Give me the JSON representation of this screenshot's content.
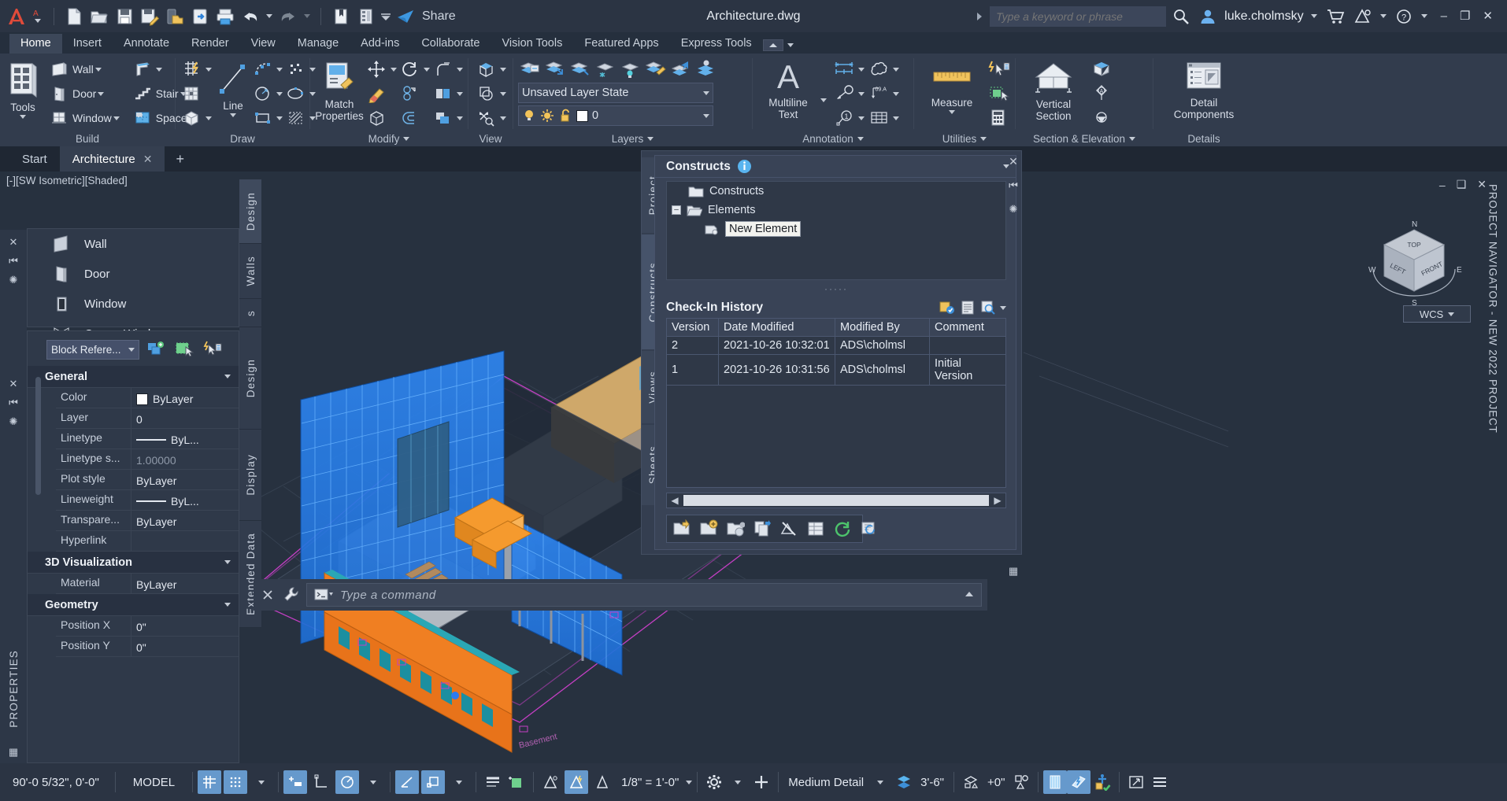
{
  "titlebar": {
    "app_icon": "autocad-A-icon",
    "quick_access": [
      {
        "name": "new-file-icon",
        "label": "New"
      },
      {
        "name": "open-file-icon",
        "label": "Open"
      },
      {
        "name": "save-icon",
        "label": "Save"
      },
      {
        "name": "save-as-icon",
        "label": "Save As"
      },
      {
        "name": "save-to-web-icon",
        "label": "Save to Web & Mobile"
      },
      {
        "name": "open-from-web-icon",
        "label": "Open from Web & Mobile"
      },
      {
        "name": "plot-icon",
        "label": "Plot"
      },
      {
        "name": "undo-icon",
        "label": "Undo"
      },
      {
        "name": "redo-icon",
        "label": "Redo"
      },
      {
        "name": "sheet-set-icon",
        "label": "Sheet Set Manager"
      },
      {
        "name": "project-navigator-icon",
        "label": "Project Navigator"
      }
    ],
    "share_label": "Share",
    "document_title": "Architecture.dwg",
    "search_placeholder": "Type a keyword or phrase",
    "user_name": "luke.cholmsky",
    "window_buttons": {
      "minimize": "–",
      "restore": "❐",
      "close": "✕"
    }
  },
  "ribbon_tabs": [
    {
      "label": "Home",
      "active": true
    },
    {
      "label": "Insert",
      "active": false
    },
    {
      "label": "Annotate",
      "active": false
    },
    {
      "label": "Render",
      "active": false
    },
    {
      "label": "View",
      "active": false
    },
    {
      "label": "Manage",
      "active": false
    },
    {
      "label": "Add-ins",
      "active": false
    },
    {
      "label": "Collaborate",
      "active": false
    },
    {
      "label": "Vision Tools",
      "active": false
    },
    {
      "label": "Featured Apps",
      "active": false
    },
    {
      "label": "Express Tools",
      "active": false
    }
  ],
  "ribbon": {
    "build": {
      "label": "Build",
      "tools_label_1": "Tools",
      "items": [
        {
          "label": "Wall",
          "icon": "wall-icon"
        },
        {
          "label": "Door",
          "icon": "door-icon"
        },
        {
          "label": "Window",
          "icon": "window-icon"
        },
        {
          "label": "",
          "icon": "curtain-wall-icon"
        },
        {
          "label": "Stair",
          "icon": "stair-icon"
        },
        {
          "label": "Space",
          "icon": "space-icon"
        }
      ]
    },
    "draw": {
      "label": "Draw",
      "line_label": "Line",
      "icons": [
        "grid-snap-icon",
        "array-icon",
        "box-icon",
        "arc-icon",
        "circle-icon",
        "rectangle-icon",
        "point-icon",
        "ellipse-icon",
        "hatch-icon"
      ]
    },
    "modify": {
      "label": "Modify",
      "match_label_1": "Match",
      "match_label_2": "Properties",
      "icons": [
        "move-icon",
        "rotate-icon",
        "fillet-icon",
        "erase-icon",
        "copy-icon",
        "mirror-icon",
        "3dsolid-icon",
        "offset-icon",
        "stretch-icon"
      ]
    },
    "view": {
      "label": "View",
      "icons": [
        "3d-view-icon",
        "section-icon",
        "explode-view-icon"
      ]
    },
    "layers": {
      "label": "Layers",
      "layer_state_value": "Unsaved Layer State",
      "layer_value": "0",
      "icons": [
        "layer-properties-icon",
        "layer-off-icon",
        "layer-isolate-icon",
        "layer-freeze-icon",
        "layer-on-icon",
        "layer-match-icon",
        "layer-previous-icon",
        "layer-walk-icon"
      ]
    },
    "annotation": {
      "label": "Annotation",
      "mtext_label_1": "Multiline",
      "mtext_label_2": "Text",
      "icons": [
        "dimension-icon",
        "revcloud-icon",
        "leader-icon",
        "tag-icon",
        "detail-bubble-icon",
        "table-icon"
      ]
    },
    "utilities": {
      "label": "Utilities",
      "measure_label": "Measure",
      "icons": [
        "quick-select-icon",
        "quick-calc-icon",
        "point-style-icon"
      ]
    },
    "section_elevation": {
      "label": "Section & Elevation",
      "vertical_label_1": "Vertical",
      "vertical_label_2": "Section",
      "icons": [
        "roof-box-icon",
        "elevation-mark-icon",
        "level-mark-icon"
      ]
    },
    "details": {
      "label": "Details",
      "detail_label_1": "Detail",
      "detail_label_2": "Components"
    }
  },
  "doc_tabs": [
    {
      "label": "Start",
      "active": false,
      "closable": false
    },
    {
      "label": "Architecture",
      "active": true,
      "closable": true
    }
  ],
  "doc_tab_add": "+",
  "viewport": {
    "label": "[-][SW Isometric][Shaded]",
    "wcs_label": "WCS",
    "viewcube_faces": {
      "top": "TOP",
      "front": "FRONT",
      "left": "LEFT"
    },
    "compass": {
      "n": "N",
      "e": "E",
      "s": "S",
      "w": "W"
    }
  },
  "tool_palette": {
    "items": [
      {
        "label": "Wall",
        "icon": "wall-tool-icon"
      },
      {
        "label": "Door",
        "icon": "door-tool-icon"
      },
      {
        "label": "Window",
        "icon": "window-tool-icon"
      },
      {
        "label": "Corner Window",
        "icon": "corner-window-tool-icon"
      }
    ],
    "tabs": [
      "Design",
      "Walls",
      "s",
      "Design",
      "Display",
      "Extended Data"
    ]
  },
  "properties": {
    "palette_title": "PROPERTIES",
    "object_type": "Block Refere...",
    "toolbar_icons": [
      "quick-select-icon",
      "select-similar-icon",
      "quick-properties-icon"
    ],
    "sections": [
      {
        "title": "General",
        "rows": [
          {
            "name": "Color",
            "value": "ByLayer",
            "swatch": "#ffffff"
          },
          {
            "name": "Layer",
            "value": "0"
          },
          {
            "name": "Linetype",
            "value": "ByL...",
            "line": true
          },
          {
            "name": "Linetype s...",
            "value": "1.00000",
            "dim": true
          },
          {
            "name": "Plot style",
            "value": "ByLayer"
          },
          {
            "name": "Lineweight",
            "value": "ByL...",
            "line": true
          },
          {
            "name": "Transpare...",
            "value": "ByLayer"
          },
          {
            "name": "Hyperlink",
            "value": ""
          }
        ]
      },
      {
        "title": "3D Visualization",
        "rows": [
          {
            "name": "Material",
            "value": "ByLayer"
          }
        ]
      },
      {
        "title": "Geometry",
        "rows": [
          {
            "name": "Position X",
            "value": "0\""
          },
          {
            "name": "Position Y",
            "value": "0\""
          }
        ]
      }
    ]
  },
  "project_navigator": {
    "strip_label": "PROJECT NAVIGATOR - NEW 2022 PROJECT",
    "tabs": [
      "Project",
      "Constructs",
      "Views",
      "Sheets"
    ],
    "active_tab": "Constructs",
    "panel_title": "Constructs",
    "info_icon": "info-icon",
    "tree": [
      {
        "label": "Constructs",
        "icon": "folder-closed-icon",
        "depth": 1,
        "expander": "",
        "selected": false
      },
      {
        "label": "Elements",
        "icon": "folder-open-icon",
        "depth": 1,
        "expander": "-",
        "selected": false
      },
      {
        "label": "New Element",
        "icon": "element-drawing-icon",
        "depth": 2,
        "expander": "",
        "selected": true
      }
    ],
    "checkin_history": {
      "title": "Check-In History",
      "header_icons": [
        "checkin-icon",
        "properties-icon",
        "find-icon",
        "menu-icon"
      ],
      "columns": [
        "Version",
        "Date Modified",
        "Modified By",
        "Comment"
      ],
      "rows": [
        {
          "version": "2",
          "date": "2021-10-26 10:32:01",
          "by": "ADS\\cholmsl",
          "comment": ""
        },
        {
          "version": "1",
          "date": "2021-10-26 10:31:56",
          "by": "ADS\\cholmsl",
          "comment": "Initial Version"
        }
      ]
    },
    "bottom_toolbar_icons": [
      "add-construct-icon",
      "new-category-icon",
      "new-from-template-icon",
      "copy-construct-icon",
      "no-detach-icon",
      "properties-grid-icon",
      "refresh-icon",
      "regenerate-icon"
    ],
    "window_buttons": {
      "close": "✕",
      "autohide": "⎮◀",
      "properties": "✲"
    }
  },
  "command_line": {
    "close_icon": "close-icon",
    "tools_icon": "wrench-icon",
    "prompt_icon": "command-prompt-icon",
    "placeholder": "Type a command",
    "expand_icon": "chevron-up-icon"
  },
  "statusbar": {
    "coordinates": "90'-0 5/32\", 0'-0\"",
    "space": "MODEL",
    "buttons": [
      {
        "name": "grid-display-button",
        "on": true
      },
      {
        "name": "snap-mode-button",
        "on": true
      },
      {
        "name": "snap-dropdown-button",
        "on": false
      },
      {
        "name": "infer-constraints-button",
        "on": true
      },
      {
        "name": "ortho-mode-button",
        "on": false
      },
      {
        "name": "polar-tracking-button",
        "on": true
      },
      {
        "name": "polar-dropdown-button",
        "on": false
      },
      {
        "name": "isometric-drafting-button",
        "on": true
      },
      {
        "name": "object-snap-tracking-button",
        "on": true
      },
      {
        "name": "osnap-dropdown-button",
        "on": false
      },
      {
        "name": "dynamic-ucs-button",
        "on": false
      },
      {
        "name": "selection-cycling-button",
        "on": false
      },
      {
        "name": "osnap-2d-button",
        "on": false
      },
      {
        "name": "osnap-3d-button",
        "on": true
      },
      {
        "name": "lineweight-button",
        "on": false
      }
    ],
    "annotation_scale": "1/8\" = 1'-0\"",
    "detail_level": "Medium Detail",
    "cut_plane": "3'-6\"",
    "elevation_offset": "+0\"",
    "right_buttons": [
      {
        "name": "isolate-objects-button",
        "on": true
      },
      {
        "name": "hardware-accel-button",
        "on": true
      },
      {
        "name": "annotation-monitor-button",
        "on": false
      },
      {
        "name": "fullscreen-button",
        "on": false
      },
      {
        "name": "customization-button",
        "on": false
      }
    ]
  }
}
